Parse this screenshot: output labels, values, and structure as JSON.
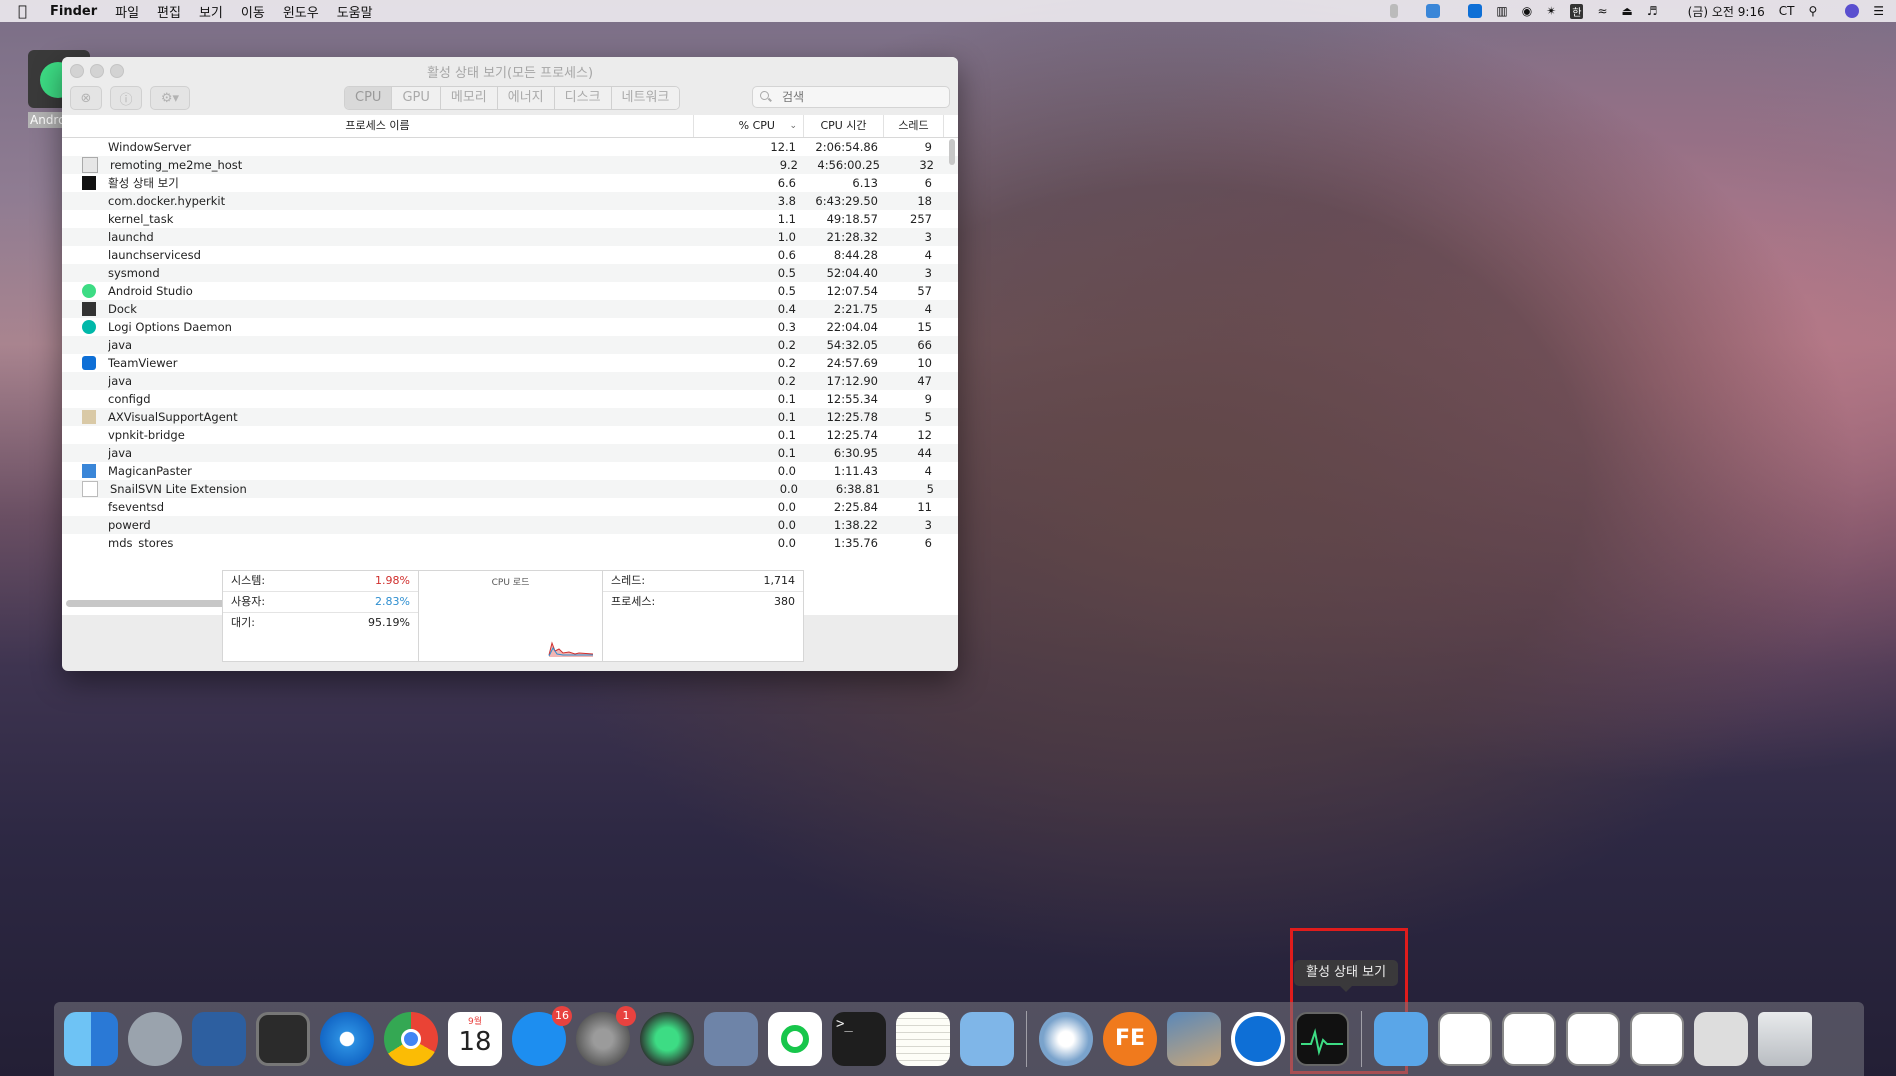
{
  "menubar": {
    "app_name": "Finder",
    "menus": [
      "파일",
      "편집",
      "보기",
      "이동",
      "윈도우",
      "도움말"
    ],
    "status": {
      "input_source": "한",
      "clock": "(금) 오전 9:16",
      "user": "CT"
    }
  },
  "desktop": {
    "icon_label": "Androic"
  },
  "window": {
    "title": "활성 상태 보기(모든 프로세스)",
    "tabs": [
      "CPU",
      "GPU",
      "메모리",
      "에너지",
      "디스크",
      "네트워크"
    ],
    "active_tab": "CPU",
    "search_placeholder": "검색",
    "columns": {
      "name": "프로세스 이름",
      "cpu": "% CPU",
      "time": "CPU 시간",
      "threads": "스레드"
    },
    "processes": [
      {
        "name": "WindowServer",
        "cpu": "12.1",
        "time": "2:06:54.86",
        "threads": "9",
        "icon": "none"
      },
      {
        "name": "remoting_me2me_host",
        "cpu": "9.2",
        "time": "4:56:00.25",
        "threads": "32",
        "icon": "doc-icon"
      },
      {
        "name": "활성 상태 보기",
        "cpu": "6.6",
        "time": "6.13",
        "threads": "6",
        "icon": "activity-monitor-icon"
      },
      {
        "name": "com.docker.hyperkit",
        "cpu": "3.8",
        "time": "6:43:29.50",
        "threads": "18",
        "icon": "none"
      },
      {
        "name": "kernel_task",
        "cpu": "1.1",
        "time": "49:18.57",
        "threads": "257",
        "icon": "none"
      },
      {
        "name": "launchd",
        "cpu": "1.0",
        "time": "21:28.32",
        "threads": "3",
        "icon": "none"
      },
      {
        "name": "launchservicesd",
        "cpu": "0.6",
        "time": "8:44.28",
        "threads": "4",
        "icon": "none"
      },
      {
        "name": "sysmond",
        "cpu": "0.5",
        "time": "52:04.40",
        "threads": "3",
        "icon": "none"
      },
      {
        "name": "Android Studio",
        "cpu": "0.5",
        "time": "12:07.54",
        "threads": "57",
        "icon": "android-studio-icon"
      },
      {
        "name": "Dock",
        "cpu": "0.4",
        "time": "2:21.75",
        "threads": "4",
        "icon": "dock-icon"
      },
      {
        "name": "Logi Options Daemon",
        "cpu": "0.3",
        "time": "22:04.04",
        "threads": "15",
        "icon": "logi-icon"
      },
      {
        "name": "java",
        "cpu": "0.2",
        "time": "54:32.05",
        "threads": "66",
        "icon": "none"
      },
      {
        "name": "TeamViewer",
        "cpu": "0.2",
        "time": "24:57.69",
        "threads": "10",
        "icon": "teamviewer-icon"
      },
      {
        "name": "java",
        "cpu": "0.2",
        "time": "17:12.90",
        "threads": "47",
        "icon": "none"
      },
      {
        "name": "configd",
        "cpu": "0.1",
        "time": "12:55.34",
        "threads": "9",
        "icon": "none"
      },
      {
        "name": "AXVisualSupportAgent",
        "cpu": "0.1",
        "time": "12:25.78",
        "threads": "5",
        "icon": "ax-agent-icon"
      },
      {
        "name": "vpnkit-bridge",
        "cpu": "0.1",
        "time": "12:25.74",
        "threads": "12",
        "icon": "none"
      },
      {
        "name": "java",
        "cpu": "0.1",
        "time": "6:30.95",
        "threads": "44",
        "icon": "none"
      },
      {
        "name": "MagicanPaster",
        "cpu": "0.0",
        "time": "1:11.43",
        "threads": "4",
        "icon": "magican-icon"
      },
      {
        "name": "SnailSVN Lite Extension",
        "cpu": "0.0",
        "time": "6:38.81",
        "threads": "5",
        "icon": "blank-doc-icon"
      },
      {
        "name": "fseventsd",
        "cpu": "0.0",
        "time": "2:25.84",
        "threads": "11",
        "icon": "none"
      },
      {
        "name": "powerd",
        "cpu": "0.0",
        "time": "1:38.22",
        "threads": "3",
        "icon": "none"
      },
      {
        "name": "mds_stores",
        "cpu": "0.0",
        "time": "1:35.76",
        "threads": "6",
        "icon": "none"
      }
    ],
    "summary": {
      "system_label": "시스템:",
      "system_value": "1.98%",
      "system_color": "#d0302e",
      "user_label": "사용자:",
      "user_value": "2.83%",
      "user_color": "#2f8fd0",
      "idle_label": "대기:",
      "idle_value": "95.19%",
      "graph_title": "CPU 로드",
      "threads_label": "스레드:",
      "threads_value": "1,714",
      "processes_label": "프로세스:",
      "processes_value": "380"
    }
  },
  "dock": {
    "tooltip": "활성 상태 보기",
    "calendar_month": "9월",
    "calendar_day": "18",
    "appstore_badge": "16",
    "settings_badge": "1",
    "terminal_prompt": ">_",
    "fe_label": "FE"
  }
}
